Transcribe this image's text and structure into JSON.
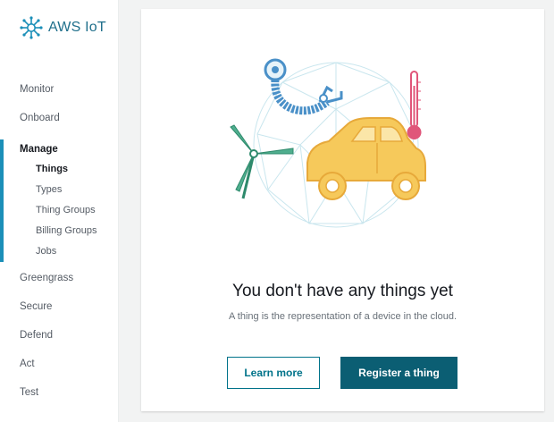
{
  "brand": {
    "title": "AWS IoT"
  },
  "nav": {
    "monitor": "Monitor",
    "onboard": "Onboard",
    "manage": {
      "title": "Manage",
      "items": [
        "Things",
        "Types",
        "Thing Groups",
        "Billing Groups",
        "Jobs"
      ]
    },
    "greengrass": "Greengrass",
    "secure": "Secure",
    "defend": "Defend",
    "act": "Act",
    "test": "Test"
  },
  "empty_state": {
    "heading": "You don't have any things yet",
    "description": "A thing is the representation of a device in the cloud.",
    "learn_more": "Learn more",
    "register": "Register a thing"
  },
  "colors": {
    "accent": "#1b8fb8",
    "primary_button": "#0b5e73",
    "car": "#f6c95b",
    "turbine": "#4fae8e",
    "thermometer": "#e0567a"
  }
}
